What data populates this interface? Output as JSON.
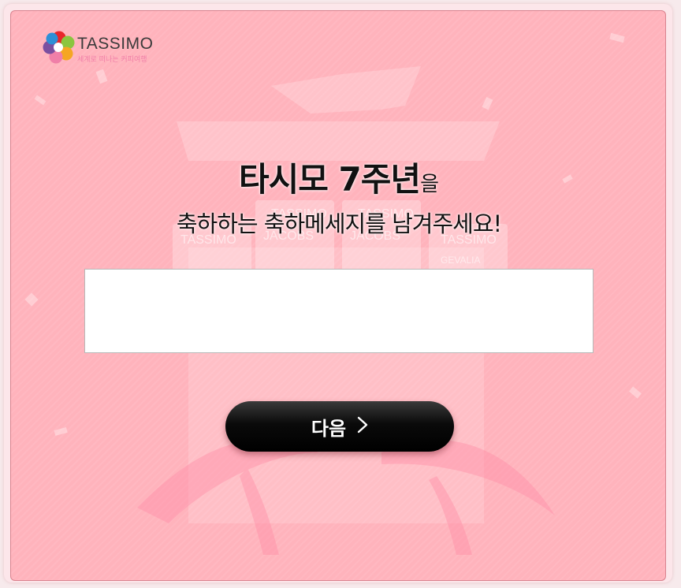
{
  "brand": {
    "name": "TASSIMO",
    "tagline": "세계로 떠나는 커피여행"
  },
  "heading": {
    "main": "타시모 7주년",
    "suffix": "을",
    "line2": "축하하는 축하메세지를 남겨주세요!"
  },
  "message": {
    "value": "",
    "placeholder": ""
  },
  "actions": {
    "next_label": "다음"
  },
  "background_products": [
    "TASSIMO",
    "JACOBS",
    "GEVALIA"
  ],
  "colors": {
    "panel": "#ffb3bc",
    "border": "#d9838f",
    "button": "#000000"
  }
}
